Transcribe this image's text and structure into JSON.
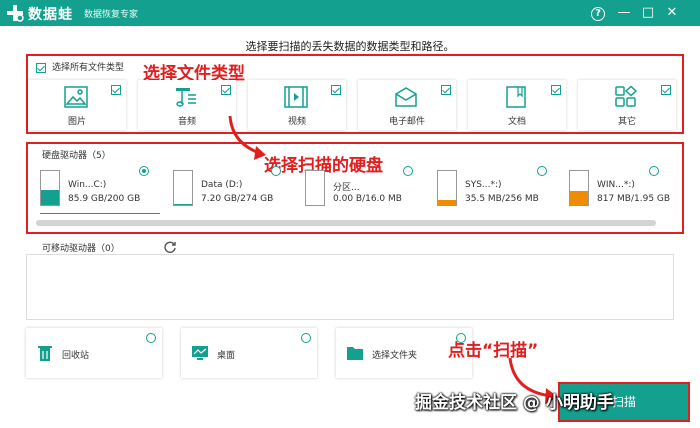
{
  "app": {
    "logo_text": "数据蛙",
    "tagline": "数据恢复专家",
    "help": "?",
    "minimize": "—",
    "maximize": "□",
    "close": "✕"
  },
  "instruction": "选择要扫描的丢失数据的数据类型和路径。",
  "annotations": {
    "select_types": "选择文件类型",
    "select_drive": "选择扫描的硬盘",
    "click_scan": "点击“扫描”"
  },
  "file_types": {
    "select_all_label": "选择所有文件类型",
    "items": [
      {
        "label": "图片",
        "icon": "image-icon"
      },
      {
        "label": "音频",
        "icon": "music-icon"
      },
      {
        "label": "视频",
        "icon": "video-icon"
      },
      {
        "label": "电子邮件",
        "icon": "email-icon"
      },
      {
        "label": "文档",
        "icon": "document-icon"
      },
      {
        "label": "其它",
        "icon": "other-icon"
      }
    ]
  },
  "hard_drives": {
    "title": "硬盘驱动器（5）",
    "items": [
      {
        "name": "Win...C:)",
        "size": "85.9 GB/200 GB",
        "fill": 0.43,
        "fill_color": "#13a08f",
        "selected": true
      },
      {
        "name": "Data (D:)",
        "size": "7.20 GB/274 GB",
        "fill": 0.03,
        "fill_color": "#13a08f",
        "selected": false
      },
      {
        "name": "分区...",
        "size": "0.00  B/16.0 MB",
        "fill": 0.0,
        "fill_color": "#f08c00",
        "selected": false
      },
      {
        "name": "SYS...*:)",
        "size": "35.5 MB/256 MB",
        "fill": 0.14,
        "fill_color": "#f08c00",
        "selected": false
      },
      {
        "name": "WIN...*:)",
        "size": "817 MB/1.95 GB",
        "fill": 0.42,
        "fill_color": "#f08c00",
        "selected": false
      }
    ]
  },
  "removable": {
    "title": "可移动驱动器（0）"
  },
  "locations": [
    {
      "label": "回收站",
      "icon": "recycle-bin-icon"
    },
    {
      "label": "桌面",
      "icon": "desktop-icon"
    },
    {
      "label": "选择文件夹",
      "icon": "folder-icon"
    }
  ],
  "scan_button": "扫描",
  "watermark": "掘金技术社区 @ 小明助手",
  "colors": {
    "accent": "#13a08f",
    "annotation": "#e02020",
    "partition_fill": "#f08c00"
  }
}
